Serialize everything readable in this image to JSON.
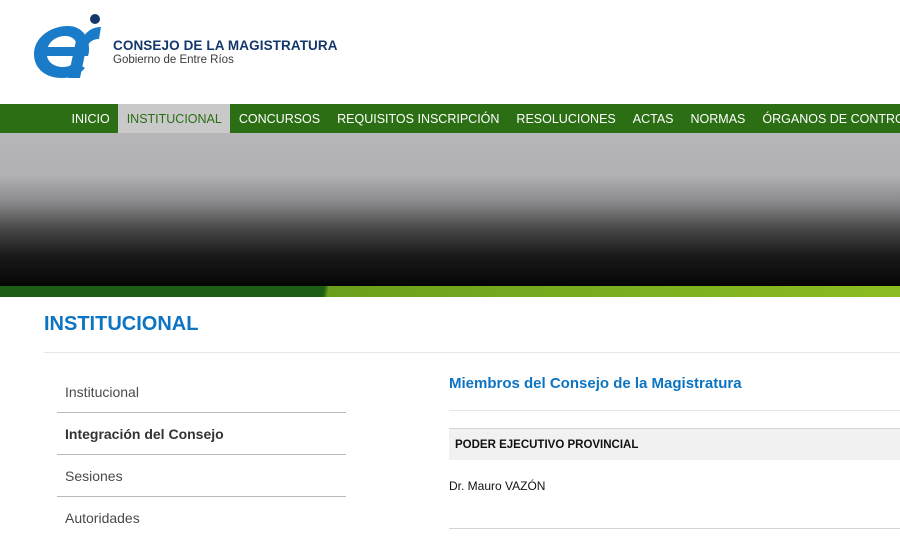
{
  "header": {
    "title": "CONSEJO DE LA MAGISTRATURA",
    "subtitle": "Gobierno de Entre Ríos",
    "logo_icon": "er-logo-icon",
    "brand_blue": "#1a7cc9",
    "brand_green": "#2b6e14"
  },
  "nav": {
    "items": [
      {
        "label": "INICIO"
      },
      {
        "label": "INSTITUCIONAL"
      },
      {
        "label": "CONCURSOS"
      },
      {
        "label": "REQUISITOS INSCRIPCIÓN"
      },
      {
        "label": "RESOLUCIONES"
      },
      {
        "label": "ACTAS"
      },
      {
        "label": "NORMAS"
      },
      {
        "label": "ÓRGANOS DE CONTROL"
      }
    ],
    "active": "INSTITUCIONAL"
  },
  "page": {
    "title": "INSTITUCIONAL"
  },
  "sidebar": {
    "items": [
      {
        "label": "Institucional"
      },
      {
        "label": "Integración del Consejo"
      },
      {
        "label": "Sesiones"
      },
      {
        "label": "Autoridades"
      }
    ],
    "active": "Integración del Consejo"
  },
  "main": {
    "section_title": "Miembros del Consejo de la Magistratura",
    "groups": [
      {
        "heading": "PODER EJECUTIVO PROVINCIAL",
        "members": [
          "Dr. Mauro VAZÓN"
        ]
      }
    ]
  }
}
